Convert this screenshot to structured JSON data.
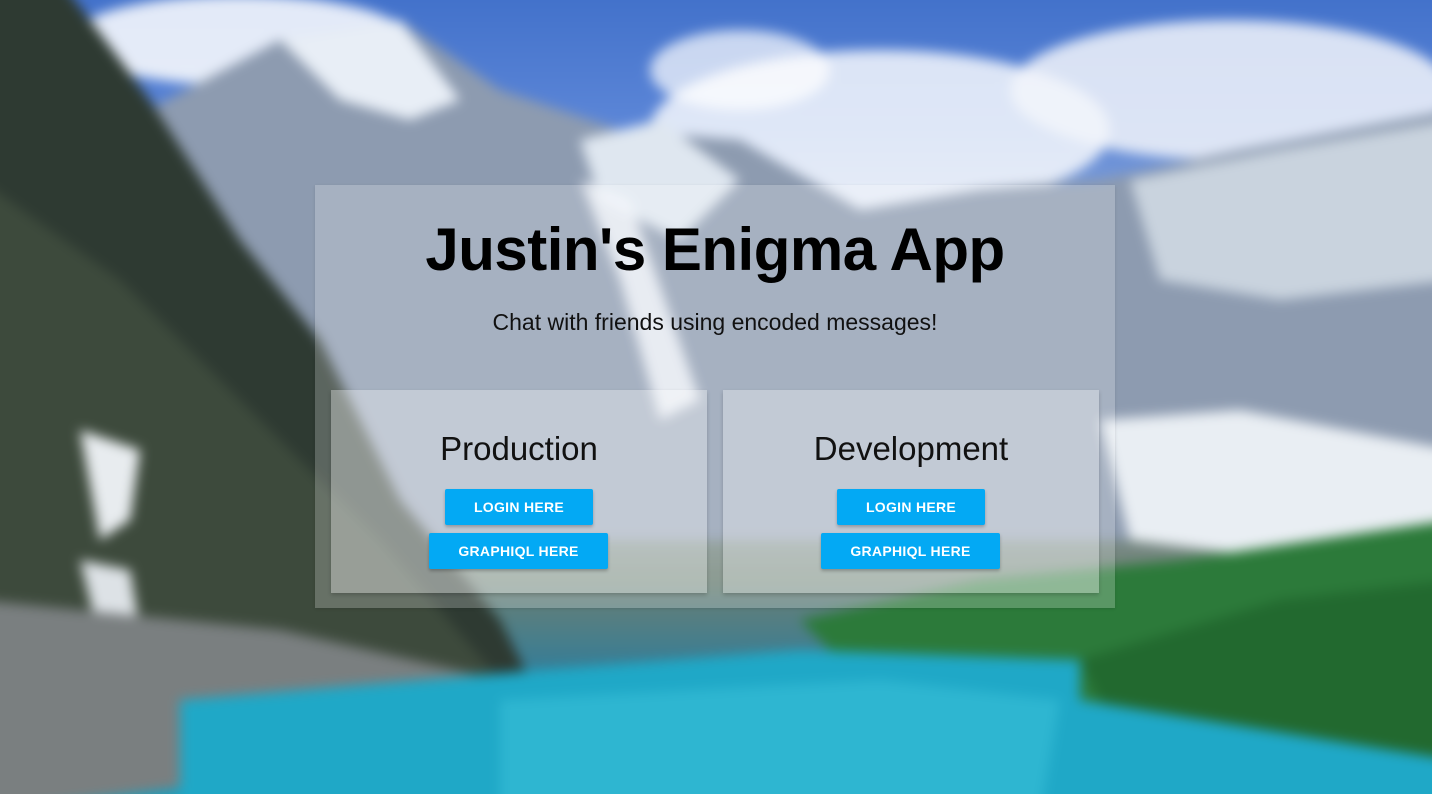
{
  "header": {
    "title": "Justin's Enigma App",
    "subtitle": "Chat with friends using encoded messages!"
  },
  "panels": [
    {
      "title": "Production",
      "login_label": "LOGIN HERE",
      "graphiql_label": "GRAPHIQL HERE"
    },
    {
      "title": "Development",
      "login_label": "LOGIN HERE",
      "graphiql_label": "GRAPHIQL HERE"
    }
  ],
  "colors": {
    "button": "#03a9f4",
    "button_text": "#ffffff",
    "title_text": "#000000"
  }
}
